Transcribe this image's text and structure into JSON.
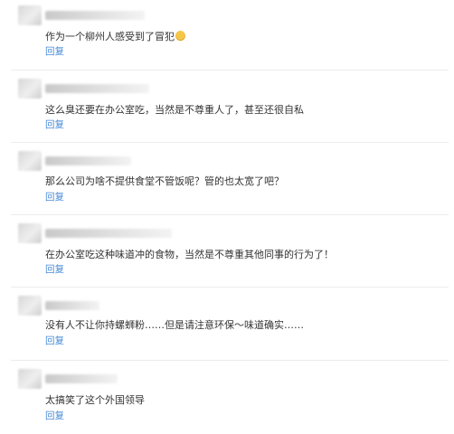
{
  "comments": [
    {
      "text": "作为一个柳州人感受到了冒犯",
      "emoji": "grinning-face-emoji",
      "reply": "回复"
    },
    {
      "text": "这么臭还要在办公室吃，当然是不尊重人了，甚至还很自私",
      "reply": "回复"
    },
    {
      "text": "那么公司为啥不提供食堂不管饭呢？管的也太宽了吧？",
      "reply": "回复"
    },
    {
      "text": "在办公室吃这种味道冲的食物，当然是不尊重其他同事的行为了！",
      "reply": "回复"
    },
    {
      "text": "没有人不让你持螺蛳粉……但是请注意环保～味道确实……",
      "reply": "回复"
    },
    {
      "text": "太搞笑了这个外国领导",
      "reply": "回复"
    }
  ]
}
